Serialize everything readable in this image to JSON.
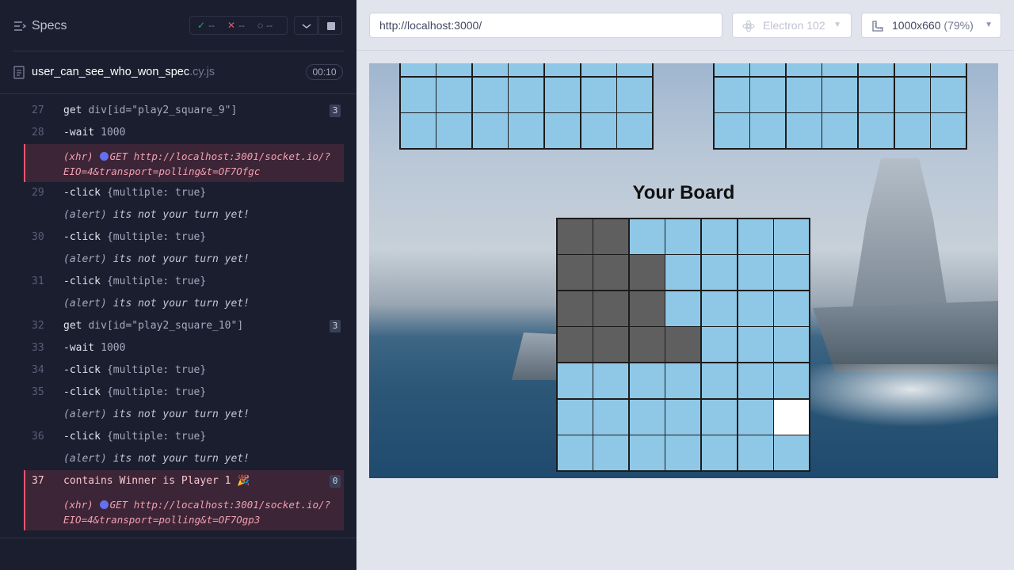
{
  "header": {
    "title": "Specs",
    "stats": {
      "passed": "--",
      "failed": "--",
      "pending": "--"
    }
  },
  "spec_file": {
    "name": "user_can_see_who_won_spec",
    "ext": ".cy.js",
    "duration": "00:10"
  },
  "log": [
    {
      "type": "cmd",
      "num": "27",
      "cmd": "get",
      "arg": "div[id=\"play2_square_9\"]",
      "badge": "3"
    },
    {
      "type": "cmd",
      "num": "28",
      "cmd": "-wait",
      "arg": "1000"
    },
    {
      "type": "xhr",
      "prefix": "(xhr)",
      "line1": "GET http://localhost:3001/socket.io/?",
      "line2": "EIO=4&transport=polling&t=OF7Ofgc"
    },
    {
      "type": "cmd",
      "num": "29",
      "cmd": "-click",
      "arg": "{multiple: true}"
    },
    {
      "type": "alert",
      "cmd": "(alert)",
      "arg": "its not your turn yet!"
    },
    {
      "type": "cmd",
      "num": "30",
      "cmd": "-click",
      "arg": "{multiple: true}"
    },
    {
      "type": "alert",
      "cmd": "(alert)",
      "arg": "its not your turn yet!"
    },
    {
      "type": "cmd",
      "num": "31",
      "cmd": "-click",
      "arg": "{multiple: true}"
    },
    {
      "type": "alert",
      "cmd": "(alert)",
      "arg": "its not your turn yet!"
    },
    {
      "type": "cmd",
      "num": "32",
      "cmd": "get",
      "arg": "div[id=\"play2_square_10\"]",
      "badge": "3"
    },
    {
      "type": "cmd",
      "num": "33",
      "cmd": "-wait",
      "arg": "1000"
    },
    {
      "type": "cmd",
      "num": "34",
      "cmd": "-click",
      "arg": "{multiple: true}"
    },
    {
      "type": "cmd",
      "num": "35",
      "cmd": "-click",
      "arg": "{multiple: true}"
    },
    {
      "type": "alert",
      "cmd": "(alert)",
      "arg": "its not your turn yet!"
    },
    {
      "type": "cmd",
      "num": "36",
      "cmd": "-click",
      "arg": "{multiple: true}"
    },
    {
      "type": "alert",
      "cmd": "(alert)",
      "arg": "its not your turn yet!"
    },
    {
      "type": "final",
      "num": "37",
      "cmd": "contains",
      "arg": "Winner is Player 1 🎉",
      "badge": "0"
    },
    {
      "type": "xhr",
      "prefix": "(xhr)",
      "line1": "GET http://localhost:3001/socket.io/?",
      "line2": "EIO=4&transport=polling&t=OF7Ogp3"
    }
  ],
  "toolbar": {
    "url": "http://localhost:3000/",
    "browser": "Electron 102",
    "viewport": "1000x660",
    "scale": "(79%)"
  },
  "app": {
    "board_title": "Your Board",
    "board": [
      [
        "ship",
        "ship",
        "water",
        "water",
        "water",
        "water",
        "water"
      ],
      [
        "ship",
        "ship",
        "ship",
        "water",
        "water",
        "water",
        "water"
      ],
      [
        "ship",
        "ship",
        "ship",
        "water",
        "water",
        "water",
        "water"
      ],
      [
        "ship",
        "ship",
        "ship",
        "ship",
        "water",
        "water",
        "water"
      ],
      [
        "water",
        "water",
        "water",
        "water",
        "water",
        "water",
        "water"
      ],
      [
        "water",
        "water",
        "water",
        "water",
        "water",
        "water",
        "hit"
      ],
      [
        "water",
        "water",
        "water",
        "water",
        "water",
        "water",
        "water"
      ]
    ]
  },
  "colors": {
    "water": "#8fc8e6",
    "ship": "#5f5f5f",
    "hit": "#ffffff",
    "pass": "#1fa971",
    "fail": "#e45770",
    "xhr_dot": "#6470f3"
  },
  "icons": [
    "specs-list-icon",
    "check-icon",
    "x-icon",
    "spinner-icon",
    "chevron-down-icon",
    "stop-icon",
    "file-icon",
    "browser-icon",
    "ruler-icon"
  ]
}
